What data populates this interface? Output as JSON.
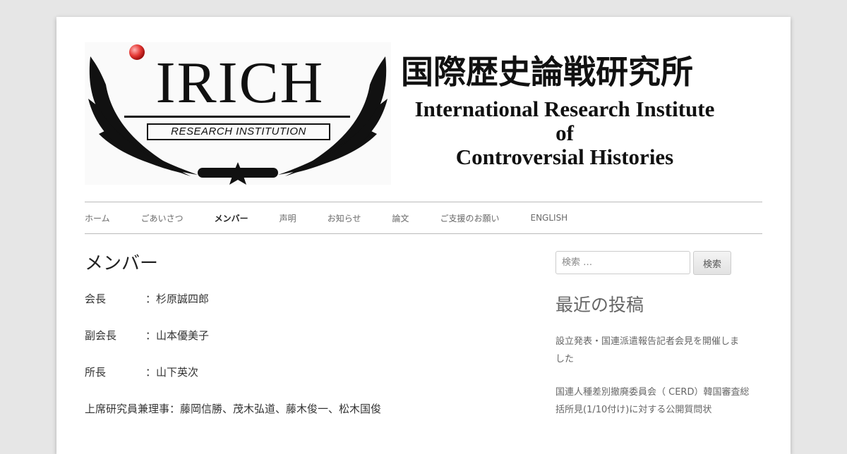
{
  "header": {
    "logo_text": "IRICH",
    "logo_subtitle": "RESEARCH INSTITUTION",
    "title_jp": "国際歴史論戦研究所",
    "title_en_line1": "International Research Institute",
    "title_en_line2": "of",
    "title_en_line3": "Controversial Histories"
  },
  "nav": {
    "items": [
      {
        "label": "ホーム"
      },
      {
        "label": "ごあいさつ"
      },
      {
        "label": "メンバー"
      },
      {
        "label": "声明"
      },
      {
        "label": "お知らせ"
      },
      {
        "label": "論文"
      },
      {
        "label": "ご支援のお願い"
      },
      {
        "label": "ENGLISH"
      }
    ],
    "active": "メンバー"
  },
  "main": {
    "title": "メンバー",
    "members": [
      {
        "role": "会長",
        "names": "：杉原誠四郎"
      },
      {
        "role": "副会長",
        "names": "：山本優美子"
      },
      {
        "role": "所長",
        "names": "：山下英次"
      },
      {
        "role": "上席研究員兼理事",
        "names": "：藤岡信勝、茂木弘道、藤木俊一、松木国俊"
      }
    ]
  },
  "sidebar": {
    "search_placeholder": "検索 …",
    "search_button": "検索",
    "recent_title": "最近の投稿",
    "recent_posts": [
      {
        "line1": "設立発表・国連派遣報告記者会見を開催しま",
        "line2": "した"
      },
      {
        "line1": "国連人種差別撤廃委員会（ CERD）韓国審査総",
        "line2": "括所見(1/10付け)に対する公開質問状"
      }
    ]
  },
  "colors": {
    "background": "#e6e6e6",
    "page": "#ffffff",
    "logo_dot": "#e53935",
    "text": "#333333"
  }
}
